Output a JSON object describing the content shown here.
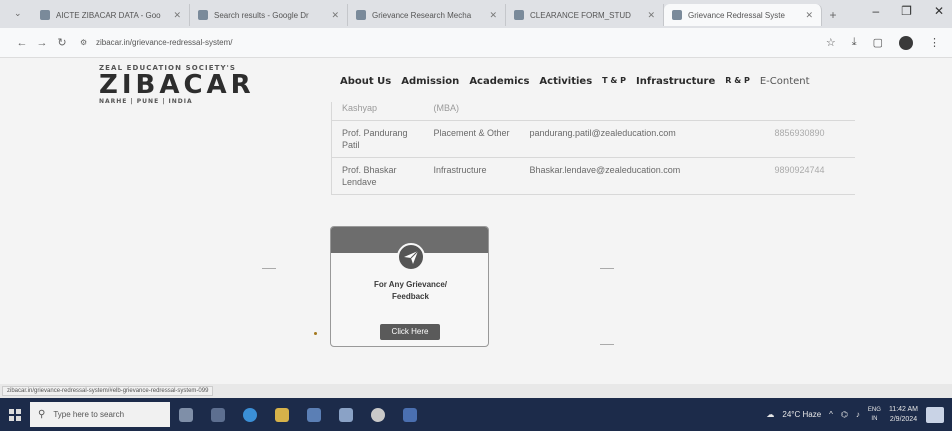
{
  "browser": {
    "tabs": [
      {
        "title": "AICTE ZIBACAR DATA - Goo",
        "active": false
      },
      {
        "title": "Search results - Google Dr",
        "active": false
      },
      {
        "title": "Grievance Research Mecha",
        "active": false
      },
      {
        "title": "CLEARANCE FORM_STUD",
        "active": false
      },
      {
        "title": "Grievance Redressal Syste",
        "active": true
      }
    ],
    "new_tab_label": "+",
    "url": "zibacar.in/grievance-redressal-system/",
    "window_controls": [
      "–",
      "❐",
      "✕"
    ]
  },
  "site": {
    "logo_top": "ZEAL EDUCATION SOCIETY'S",
    "logo_main": "ZIBACAR",
    "logo_sub": "NARHE | PUNE | INDIA",
    "nav": [
      "About Us",
      "Admission",
      "Academics",
      "Activities",
      "T & P",
      "Infrastructure",
      "R & P",
      "E-Content"
    ]
  },
  "table": {
    "partial_row": {
      "name": "Kashyap",
      "dept": "(MBA)"
    },
    "rows": [
      {
        "name": "Prof. Pandurang Patil",
        "dept": "Placement & Other",
        "email": "pandurang.patil@zealeducation.com",
        "phone": "8856930890"
      },
      {
        "name": "Prof. Bhaskar Lendave",
        "dept": "Infrastructure",
        "email": "Bhaskar.lendave@zealeducation.com",
        "phone": "9890924744"
      }
    ]
  },
  "card": {
    "icon": "paper-plane-icon",
    "title_line1": "For Any Grievance/",
    "title_line2": "Feedback",
    "button": "Click Here"
  },
  "status_link": "zibacar.in/grievance-redressal-system/#elb-grievance-redressal-system-099",
  "taskbar": {
    "search_placeholder": "Type here to search",
    "weather": "24°C Haze",
    "lang_top": "ENG",
    "lang_bottom": "IN",
    "time": "11:42 AM",
    "date": "2/9/2024"
  },
  "colors": {
    "taskbar": "#1c2b4a",
    "card_head": "#6d6d6d",
    "button": "#5a5a5a"
  }
}
